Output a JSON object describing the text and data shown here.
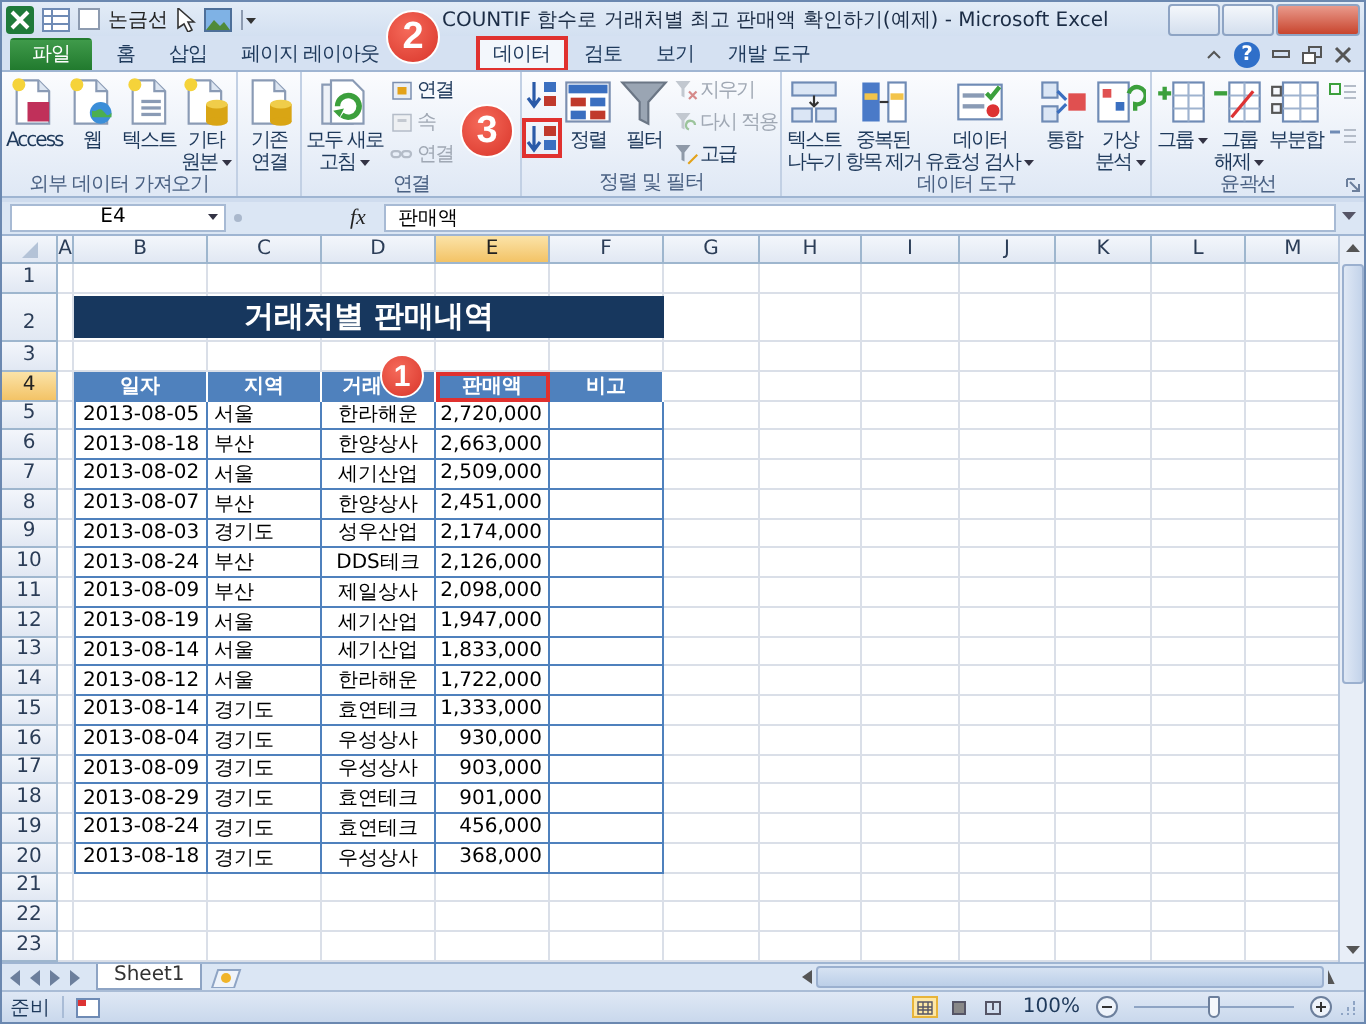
{
  "title_bar": {
    "document_label": "논금선",
    "title": "COUNTIF 함수로 거래처별 최고 판매액 확인하기(예제) - Microsoft Excel"
  },
  "tabs": [
    {
      "label": "파일",
      "kind": "file",
      "selected": false,
      "highlighted": false
    },
    {
      "label": "홈",
      "kind": "tab",
      "selected": false,
      "highlighted": false
    },
    {
      "label": "삽입",
      "kind": "tab",
      "selected": false,
      "highlighted": false
    },
    {
      "label": "페이지 레이아웃",
      "kind": "tab",
      "selected": false,
      "highlighted": false
    },
    {
      "label": "데이터",
      "kind": "tab",
      "selected": true,
      "highlighted": true
    },
    {
      "label": "검토",
      "kind": "tab",
      "selected": false,
      "highlighted": false
    },
    {
      "label": "보기",
      "kind": "tab",
      "selected": false,
      "highlighted": false
    },
    {
      "label": "개발 도구",
      "kind": "tab",
      "selected": false,
      "highlighted": false
    }
  ],
  "help_label": "?",
  "ribbon_groups": [
    {
      "label": "외부 데이터 가져오기",
      "launcher": false,
      "items": [
        {
          "kind": "large",
          "lines": [
            "Access"
          ],
          "dropdown": false
        },
        {
          "kind": "large",
          "lines": [
            "웹"
          ],
          "dropdown": false
        },
        {
          "kind": "large",
          "lines": [
            "텍스트"
          ],
          "dropdown": false
        },
        {
          "kind": "large",
          "lines": [
            "기타",
            "원본"
          ],
          "dropdown": true
        }
      ]
    },
    {
      "launcher": false,
      "items": [
        {
          "kind": "large",
          "lines": [
            "기존",
            "연결"
          ],
          "dropdown": false
        }
      ]
    },
    {
      "label": "연결",
      "launcher": false,
      "items": [
        {
          "kind": "large",
          "lines": [
            "모두 새로",
            "고침"
          ],
          "dropdown": true
        },
        {
          "kind": "stack",
          "items": [
            {
              "kind": "small",
              "label": "연결",
              "disabled": false
            },
            {
              "kind": "small",
              "label": "속",
              "disabled": true
            },
            {
              "kind": "small",
              "label": "연결",
              "disabled": true
            }
          ]
        }
      ]
    },
    {
      "label": "정렬 및 필터",
      "launcher": false,
      "items": [
        {
          "kind": "stack",
          "items": [
            {
              "kind": "icon",
              "highlighted": false
            },
            {
              "kind": "icon",
              "highlighted": true
            }
          ]
        },
        {
          "kind": "large",
          "lines": [
            "정렬"
          ],
          "dropdown": false
        },
        {
          "kind": "large",
          "lines": [
            "필터"
          ],
          "dropdown": false
        },
        {
          "kind": "stack",
          "items": [
            {
              "kind": "small",
              "label": "지우기",
              "disabled": true
            },
            {
              "kind": "small",
              "label": "다시 적용",
              "disabled": true
            },
            {
              "kind": "small",
              "label": "고급",
              "disabled": false
            }
          ]
        }
      ]
    },
    {
      "label": "데이터 도구",
      "launcher": false,
      "items": [
        {
          "kind": "large",
          "lines": [
            "텍스트",
            "나누기"
          ],
          "dropdown": false
        },
        {
          "kind": "large",
          "lines": [
            "중복된",
            "항목 제거"
          ],
          "dropdown": false
        },
        {
          "kind": "large",
          "lines": [
            "데이터",
            "유효성 검사"
          ],
          "dropdown": true
        },
        {
          "kind": "large",
          "lines": [
            "통합"
          ],
          "dropdown": false
        },
        {
          "kind": "large",
          "lines": [
            "가상",
            "분석"
          ],
          "dropdown": true
        }
      ]
    },
    {
      "label": "윤곽선",
      "launcher": true,
      "items": [
        {
          "kind": "large",
          "lines": [
            "그룹"
          ],
          "dropdown": true
        },
        {
          "kind": "large",
          "lines": [
            "그룹",
            "해제"
          ],
          "dropdown": true
        },
        {
          "kind": "large",
          "lines": [
            "부분합"
          ],
          "dropdown": false
        },
        {
          "kind": "stack",
          "items": [
            {
              "kind": "icon",
              "highlighted": false
            },
            {
              "kind": "icon",
              "highlighted": false
            }
          ]
        }
      ]
    }
  ],
  "formula_bar": {
    "name_box": "E4",
    "function_button": "fx",
    "formula": "판매액"
  },
  "sheet": {
    "columns": [
      {
        "label": "A",
        "selected": false
      },
      {
        "label": "B",
        "selected": false
      },
      {
        "label": "C",
        "selected": false
      },
      {
        "label": "D",
        "selected": false
      },
      {
        "label": "E",
        "selected": true
      },
      {
        "label": "F",
        "selected": false
      },
      {
        "label": "G",
        "selected": false
      },
      {
        "label": "H",
        "selected": false
      },
      {
        "label": "I",
        "selected": false
      },
      {
        "label": "J",
        "selected": false
      },
      {
        "label": "K",
        "selected": false
      },
      {
        "label": "L",
        "selected": false
      },
      {
        "label": "M",
        "selected": false
      }
    ],
    "rows": [
      {
        "label": "1",
        "selected": false
      },
      {
        "label": "2",
        "selected": false
      },
      {
        "label": "3",
        "selected": false
      },
      {
        "label": "4",
        "selected": true
      },
      {
        "label": "5",
        "selected": false
      },
      {
        "label": "6",
        "selected": false
      },
      {
        "label": "7",
        "selected": false
      },
      {
        "label": "8",
        "selected": false
      },
      {
        "label": "9",
        "selected": false
      },
      {
        "label": "10",
        "selected": false
      },
      {
        "label": "11",
        "selected": false
      },
      {
        "label": "12",
        "selected": false
      },
      {
        "label": "13",
        "selected": false
      },
      {
        "label": "14",
        "selected": false
      },
      {
        "label": "15",
        "selected": false
      },
      {
        "label": "16",
        "selected": false
      },
      {
        "label": "17",
        "selected": false
      },
      {
        "label": "18",
        "selected": false
      },
      {
        "label": "19",
        "selected": false
      },
      {
        "label": "20",
        "selected": false
      },
      {
        "label": "21",
        "selected": false
      },
      {
        "label": "22",
        "selected": false
      },
      {
        "label": "23",
        "selected": false
      }
    ],
    "title": "거래처별 판매내역",
    "table": {
      "headers": [
        {
          "label": "일자",
          "highlighted": false
        },
        {
          "label": "지역",
          "highlighted": false
        },
        {
          "label": "거래",
          "highlighted": false
        },
        {
          "label": "판매액",
          "highlighted": true
        },
        {
          "label": "비고",
          "highlighted": false
        }
      ],
      "rows": [
        {
          "date": "2013-08-05",
          "region": "서울",
          "client": "한라해운",
          "amount": "2,720,000"
        },
        {
          "date": "2013-08-18",
          "region": "부산",
          "client": "한양상사",
          "amount": "2,663,000"
        },
        {
          "date": "2013-08-02",
          "region": "서울",
          "client": "세기산업",
          "amount": "2,509,000"
        },
        {
          "date": "2013-08-07",
          "region": "부산",
          "client": "한양상사",
          "amount": "2,451,000"
        },
        {
          "date": "2013-08-03",
          "region": "경기도",
          "client": "성우산업",
          "amount": "2,174,000"
        },
        {
          "date": "2013-08-24",
          "region": "부산",
          "client": "DDS테크",
          "amount": "2,126,000"
        },
        {
          "date": "2013-08-09",
          "region": "부산",
          "client": "제일상사",
          "amount": "2,098,000"
        },
        {
          "date": "2013-08-19",
          "region": "서울",
          "client": "세기산업",
          "amount": "1,947,000"
        },
        {
          "date": "2013-08-14",
          "region": "서울",
          "client": "세기산업",
          "amount": "1,833,000"
        },
        {
          "date": "2013-08-12",
          "region": "서울",
          "client": "한라해운",
          "amount": "1,722,000"
        },
        {
          "date": "2013-08-14",
          "region": "경기도",
          "client": "효연테크",
          "amount": "1,333,000"
        },
        {
          "date": "2013-08-04",
          "region": "경기도",
          "client": "우성상사",
          "amount": "930,000"
        },
        {
          "date": "2013-08-09",
          "region": "경기도",
          "client": "우성상사",
          "amount": "903,000"
        },
        {
          "date": "2013-08-29",
          "region": "경기도",
          "client": "효연테크",
          "amount": "901,000"
        },
        {
          "date": "2013-08-24",
          "region": "경기도",
          "client": "효연테크",
          "amount": "456,000"
        },
        {
          "date": "2013-08-18",
          "region": "경기도",
          "client": "우성상사",
          "amount": "368,000"
        }
      ]
    }
  },
  "sheet_tabs": [
    {
      "label": "Sheet1",
      "selected": true
    }
  ],
  "status_bar": {
    "status": "준비",
    "views": [
      {
        "selected": true
      },
      {
        "selected": false
      },
      {
        "selected": false
      }
    ],
    "zoom": "100%",
    "zoom_slider": {
      "level": 0.5
    }
  },
  "callouts": [
    {
      "label": "1"
    },
    {
      "label": "2"
    },
    {
      "label": "3"
    }
  ]
}
